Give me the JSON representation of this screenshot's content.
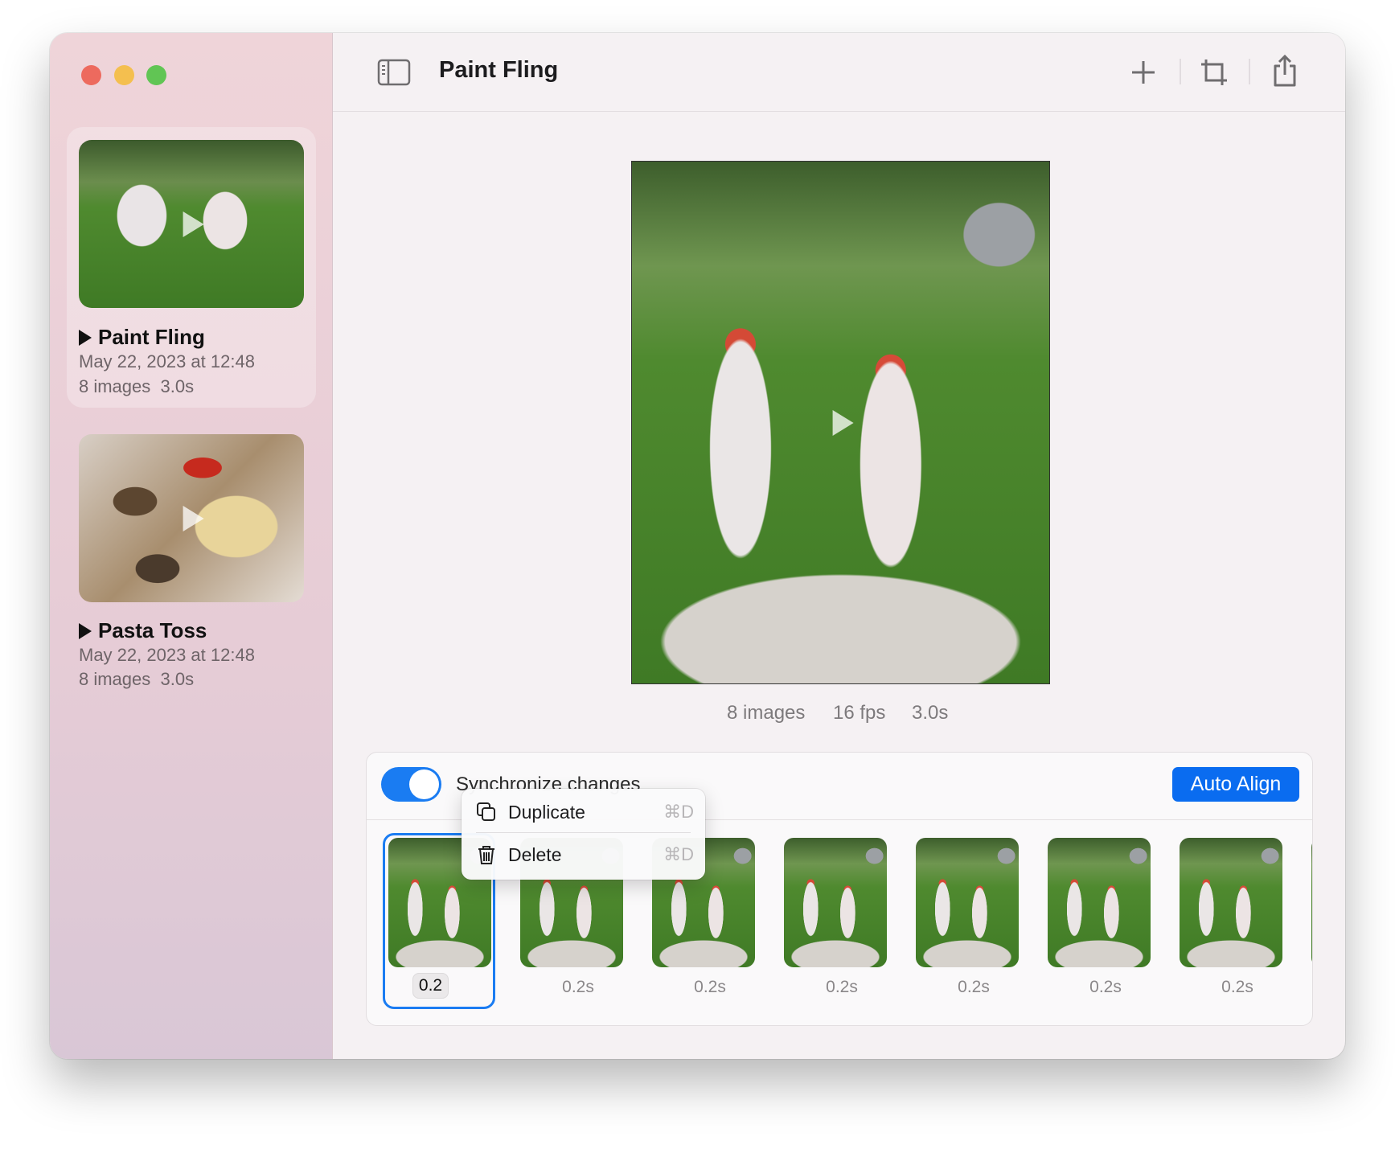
{
  "window": {
    "title": "Paint Fling",
    "traffic_lights": {
      "close": "#ed6a5e",
      "minimize": "#f4bf4f",
      "zoom": "#61c554"
    }
  },
  "sidebar": {
    "items": [
      {
        "title": "Paint Fling",
        "date": "May 22, 2023 at 12:48",
        "images": "8 images",
        "duration": "3.0s",
        "selected": true,
        "thumbnail": "paint-fling-photo"
      },
      {
        "title": "Pasta Toss",
        "date": "May 22, 2023 at 12:48",
        "images": "8 images",
        "duration": "3.0s",
        "selected": false,
        "thumbnail": "pasta-photo"
      }
    ]
  },
  "toolbar": {
    "icons": [
      "sidebar-toggle-icon",
      "plus-icon",
      "crop-icon",
      "share-icon"
    ]
  },
  "preview": {
    "images": "8 images",
    "fps": "16 fps",
    "duration": "3.0s"
  },
  "panel": {
    "sync_label": "Synchronize changes",
    "sync_on": true,
    "auto_align_label": "Auto Align",
    "frames": [
      {
        "label": "0.2",
        "editing": true
      },
      {
        "label": "0.2s"
      },
      {
        "label": "0.2s"
      },
      {
        "label": "0.2s"
      },
      {
        "label": "0.2s"
      },
      {
        "label": "0.2s"
      },
      {
        "label": "0.2s"
      }
    ]
  },
  "context_menu": {
    "items": [
      {
        "label": "Duplicate",
        "shortcut": "⌘D",
        "icon": "duplicate-icon"
      },
      {
        "label": "Delete",
        "shortcut": "⌘D",
        "icon": "trash-icon"
      }
    ]
  },
  "colors": {
    "accent": "#0a6cf0",
    "toggle": "#1a7cf2"
  }
}
